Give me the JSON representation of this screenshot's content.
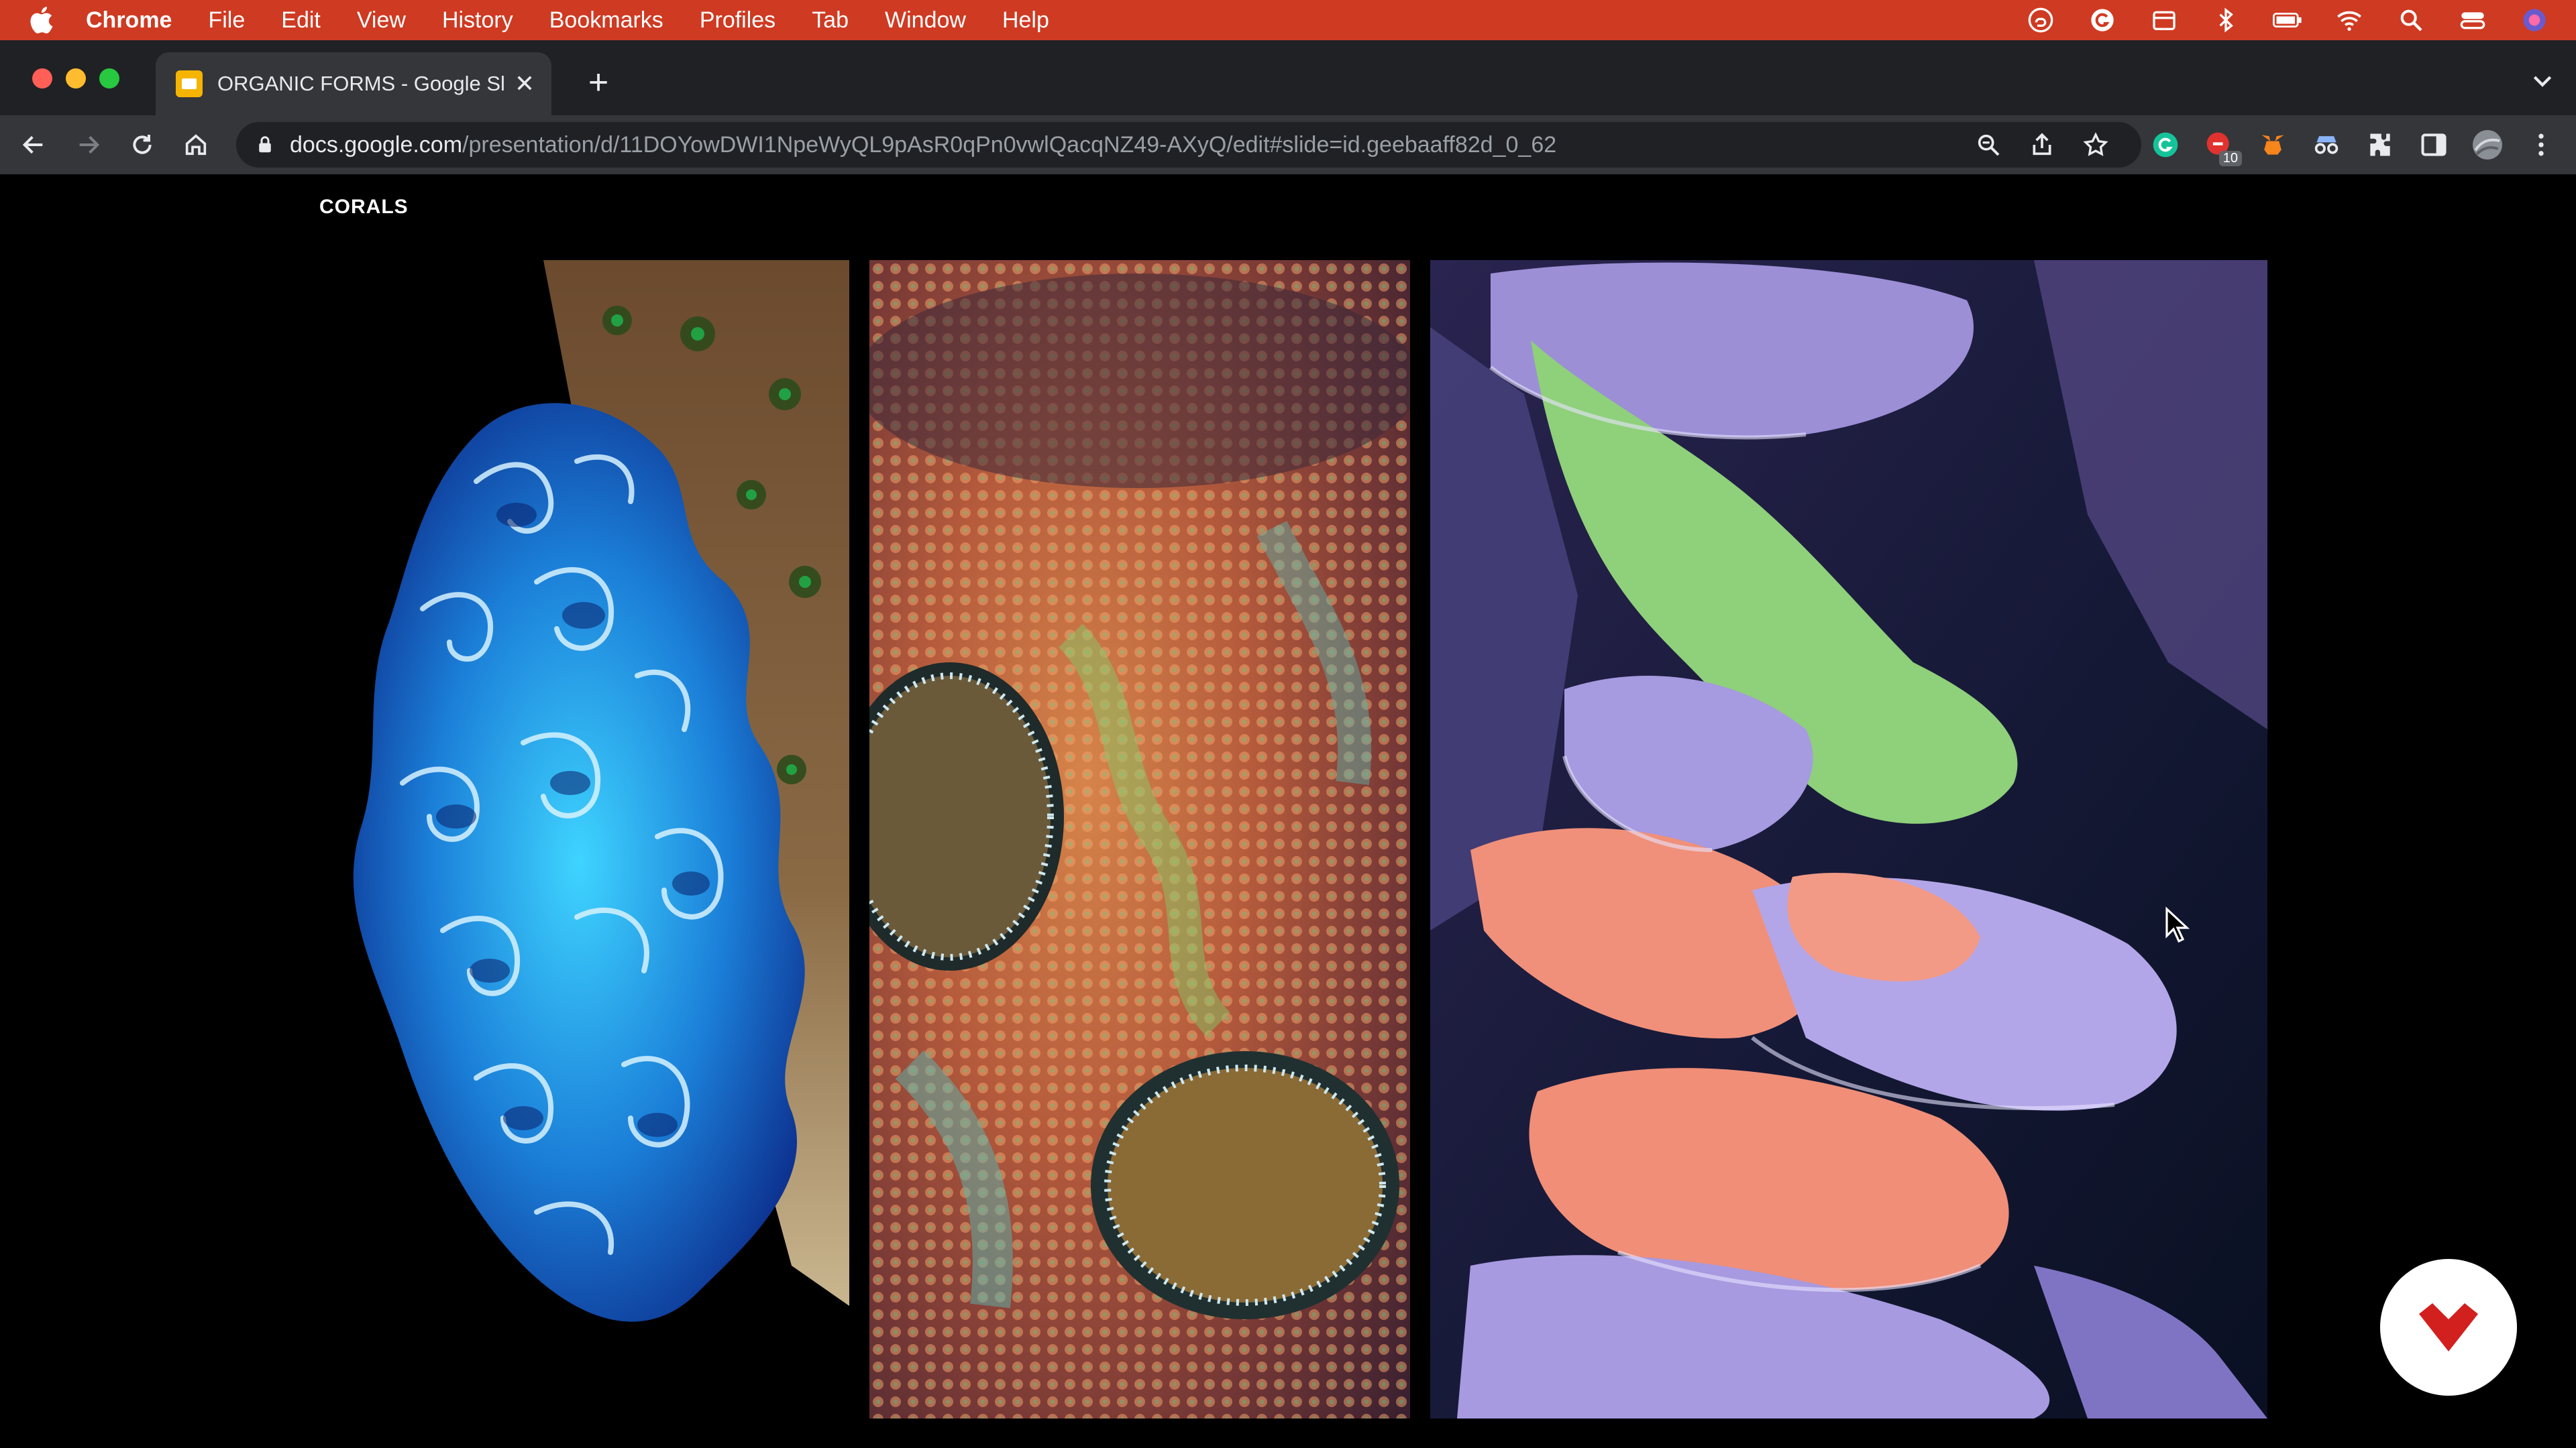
{
  "menubar": {
    "app_name": "Chrome",
    "items": [
      "File",
      "Edit",
      "View",
      "History",
      "Bookmarks",
      "Profiles",
      "Tab",
      "Window",
      "Help"
    ],
    "status_icons": [
      "creative-cloud-icon",
      "grammarly-icon",
      "calendar-icon",
      "bluetooth-icon",
      "battery-icon",
      "wifi-icon",
      "spotlight-icon",
      "control-center-icon",
      "siri-icon"
    ]
  },
  "tab": {
    "title": "ORGANIC FORMS - Google Slides",
    "close_glyph": "✕"
  },
  "newtab_glyph": "+",
  "address": {
    "host": "docs.google.com",
    "path": "/presentation/d/11DOYowDWI1NpeWyQL9pAsR0qPn0vwlQacqNZ49-AXyQ/edit#slide=id.geebaaff82d_0_62"
  },
  "extensions": {
    "badge_count": "10"
  },
  "slide": {
    "title": "CORALS",
    "images": [
      "blue-lettuce-coral-photo",
      "acan-coral-photo",
      "montipora-plate-coral-photo"
    ]
  },
  "colors": {
    "menubar": "#cf3a22",
    "tabstrip": "#202124",
    "toolbar": "#35363a",
    "fab_icon": "#d2201f"
  }
}
